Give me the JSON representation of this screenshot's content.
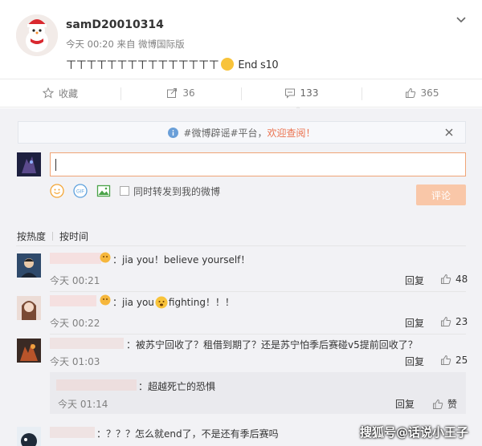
{
  "post": {
    "username": "samD20010314",
    "meta": "今天 00:20 来自 微博国际版",
    "text_prefix": "ㄒㄒㄒㄒㄒㄒㄒㄒㄒㄒㄒㄒㄒㄒㄒ",
    "text_suffix": " End s10"
  },
  "actions": {
    "favorite": "收藏",
    "forward": "36",
    "comment": "133",
    "like": "365"
  },
  "notice": {
    "text_main": "#微博辟谣#平台，",
    "text_link": "欢迎查阅！"
  },
  "composer": {
    "forward_label": "同时转发到我的微博",
    "submit_label": "评论"
  },
  "sort": {
    "hot": "按热度",
    "time": "按时间"
  },
  "comments": [
    {
      "text": "：jia you！believe yourself！",
      "time": "今天 00:21",
      "reply": "回复",
      "likes": "48"
    },
    {
      "text": "：jia you",
      "text2": "fighting！！！",
      "time": "今天 00:22",
      "reply": "回复",
      "likes": "23"
    },
    {
      "text": "：被苏宁回收了？租借到期了？还是苏宁怕季后赛碰v5提前回收了？",
      "time": "今天 01:03",
      "reply": "回复",
      "likes": "25"
    },
    {
      "text": "：？？？怎么就end了，不是还有季后赛吗"
    }
  ],
  "subreply": {
    "text": "：超越死亡的恐惧",
    "time": "今天 01:14",
    "reply": "回复",
    "like": "赞"
  },
  "watermark": "搜狐号@话说小王子"
}
